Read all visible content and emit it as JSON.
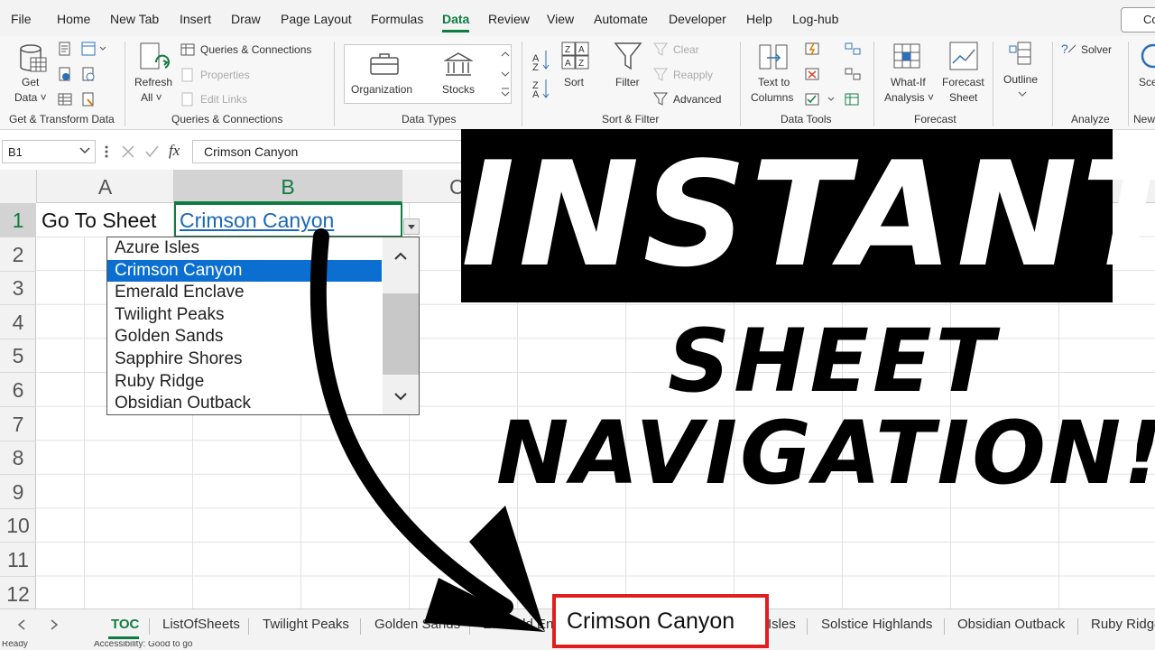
{
  "menu": {
    "items": [
      "File",
      "Home",
      "New Tab",
      "Insert",
      "Draw",
      "Page Layout",
      "Formulas",
      "Data",
      "Review",
      "View",
      "Automate",
      "Developer",
      "Help",
      "Log-hub"
    ],
    "active": "Data",
    "share": "Co"
  },
  "ribbon": {
    "get_data": {
      "line1": "Get",
      "line2": "Data ˅"
    },
    "refresh": {
      "line1": "Refresh",
      "line2": "All ˅"
    },
    "queries": [
      "Queries & Connections",
      "Properties",
      "Edit Links"
    ],
    "organization": "Organization",
    "stocks": "Stocks",
    "sort": "Sort",
    "filter": "Filter",
    "clear": "Clear",
    "reapply": "Reapply",
    "advanced": "Advanced",
    "text_to_columns": {
      "line1": "Text to",
      "line2": "Columns"
    },
    "whatif": {
      "line1": "What-If",
      "line2": "Analysis ˅"
    },
    "forecast": {
      "line1": "Forecast",
      "line2": "Sheet"
    },
    "outline": "Outline",
    "solver": "Solver",
    "sce": "Sce",
    "groups": [
      "Get & Transform Data",
      "Queries & Connections",
      "Data Types",
      "Sort & Filter",
      "Data Tools",
      "Forecast",
      "Analyze",
      "New"
    ]
  },
  "formula": {
    "namebox": "B1",
    "fx": "fx",
    "value": "Crimson Canyon"
  },
  "columns": [
    "A",
    "B",
    "C"
  ],
  "rows": [
    "1",
    "2",
    "3",
    "4",
    "5",
    "6",
    "7",
    "8",
    "9",
    "10",
    "11",
    "12"
  ],
  "cells": {
    "A1": "Go To Sheet",
    "B1": "Crimson Canyon"
  },
  "dropdown": {
    "options": [
      "Azure Isles",
      "Crimson Canyon",
      "Emerald Enclave",
      "Twilight Peaks",
      "Golden Sands",
      "Sapphire Shores",
      "Ruby Ridge",
      "Obsidian Outback"
    ],
    "selected": "Crimson Canyon"
  },
  "overlay": {
    "line1": "INSTANT",
    "line2": "SHEET",
    "line3": "NAVIGATION!"
  },
  "tabs": [
    "TOC",
    "ListOfSheets",
    "Twilight Peaks",
    "Golden Sands",
    "Emerald Enc",
    "Crimson Canyon",
    "Isles",
    "Solstice Highlands",
    "Obsidian Outback",
    "Ruby Ridge"
  ],
  "status": {
    "ready": "Ready",
    "accessibility": "Accessibility: Good to go"
  },
  "colors": {
    "accent": "#107c41",
    "link": "#1b69b6",
    "highlight": "#0a6fd1",
    "tab_outline": "#e01e1e"
  }
}
